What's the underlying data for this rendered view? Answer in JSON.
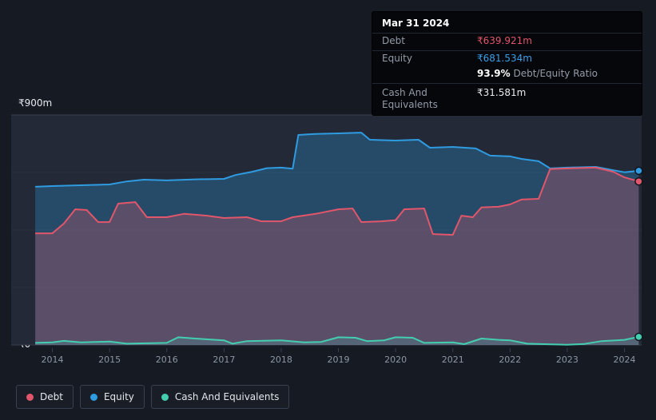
{
  "page": {
    "bg_color": "#151a23",
    "plot_bg_color": "#232936"
  },
  "tooltip": {
    "date": "Mar 31 2024",
    "rows": {
      "debt": {
        "label": "Debt",
        "value": "₹639.921m",
        "color": "#e2566b"
      },
      "equity": {
        "label": "Equity",
        "value": "₹681.534m",
        "color": "#3aa0e8"
      },
      "ratio": {
        "value": "93.9%",
        "label": "Debt/Equity Ratio"
      },
      "cash": {
        "label": "Cash And Equivalents",
        "value": "₹31.581m",
        "color": "#e8eaed"
      }
    }
  },
  "legend": {
    "items": [
      {
        "label": "Debt",
        "color": "#e2566b"
      },
      {
        "label": "Equity",
        "color": "#2f9be0"
      },
      {
        "label": "Cash And Equivalents",
        "color": "#43ceb0"
      }
    ]
  },
  "chart_data": {
    "type": "area",
    "xlim": [
      2013.28,
      2024.3
    ],
    "ylim": [
      0,
      900
    ],
    "x_ticks": [
      2014,
      2015,
      2016,
      2017,
      2018,
      2019,
      2020,
      2021,
      2022,
      2023,
      2024
    ],
    "y_gridlines": [
      225,
      450,
      675
    ],
    "y_axis_labels": [
      {
        "value": 900,
        "label": "₹900m"
      },
      {
        "value": 0,
        "label": "₹0"
      }
    ],
    "grid": true,
    "legend_position": "bottom-left",
    "series": [
      {
        "name": "Equity",
        "color": "#2f9be0",
        "fill": "rgba(47,155,224,0.30)",
        "x": [
          2013.7,
          2014.0,
          2014.5,
          2015.0,
          2015.3,
          2015.6,
          2016.0,
          2016.5,
          2017.0,
          2017.2,
          2017.5,
          2017.75,
          2018.0,
          2018.2,
          2018.3,
          2018.6,
          2019.0,
          2019.4,
          2019.55,
          2020.0,
          2020.4,
          2020.6,
          2021.0,
          2021.4,
          2021.65,
          2022.0,
          2022.2,
          2022.5,
          2022.7,
          2023.0,
          2023.5,
          2023.8,
          2024.0,
          2024.25
        ],
        "values": [
          619,
          622,
          625,
          628,
          640,
          647,
          644,
          648,
          650,
          665,
          678,
          692,
          694,
          690,
          822,
          826,
          828,
          831,
          803,
          800,
          803,
          772,
          775,
          769,
          741,
          738,
          728,
          719,
          691,
          694,
          697,
          684,
          676,
          681.5
        ]
      },
      {
        "name": "Debt",
        "color": "#e2566b",
        "fill": "rgba(226,86,107,0.28)",
        "x": [
          2013.7,
          2014.0,
          2014.2,
          2014.4,
          2014.6,
          2014.8,
          2015.0,
          2015.15,
          2015.45,
          2015.65,
          2016.0,
          2016.3,
          2016.7,
          2017.0,
          2017.4,
          2017.65,
          2018.0,
          2018.2,
          2018.6,
          2019.0,
          2019.25,
          2019.4,
          2019.75,
          2020.0,
          2020.15,
          2020.5,
          2020.65,
          2021.0,
          2021.15,
          2021.35,
          2021.5,
          2021.8,
          2022.0,
          2022.2,
          2022.5,
          2022.7,
          2023.0,
          2023.5,
          2023.8,
          2024.0,
          2024.25
        ],
        "values": [
          437,
          437,
          475,
          531,
          528,
          481,
          481,
          553,
          559,
          500,
          500,
          513,
          506,
          497,
          500,
          484,
          484,
          500,
          513,
          531,
          534,
          481,
          484,
          488,
          531,
          534,
          434,
          431,
          506,
          500,
          538,
          541,
          550,
          569,
          572,
          688,
          691,
          694,
          678,
          656,
          639.9
        ]
      },
      {
        "name": "Cash And Equivalents",
        "color": "#43ceb0",
        "fill": "rgba(67,206,176,0.18)",
        "x": [
          2013.7,
          2014.0,
          2014.2,
          2014.5,
          2015.0,
          2015.3,
          2016.0,
          2016.2,
          2016.5,
          2017.0,
          2017.15,
          2017.4,
          2018.0,
          2018.4,
          2018.7,
          2019.0,
          2019.3,
          2019.5,
          2019.8,
          2020.0,
          2020.3,
          2020.5,
          2021.0,
          2021.2,
          2021.5,
          2021.8,
          2022.0,
          2022.3,
          2022.6,
          2023.0,
          2023.3,
          2023.6,
          2024.0,
          2024.25
        ],
        "values": [
          8,
          10,
          16,
          10,
          13,
          5,
          8,
          30,
          25,
          18,
          5,
          15,
          18,
          10,
          12,
          30,
          28,
          15,
          18,
          30,
          28,
          8,
          10,
          3,
          25,
          20,
          18,
          5,
          3,
          1,
          4,
          15,
          20,
          31.6
        ]
      }
    ]
  }
}
